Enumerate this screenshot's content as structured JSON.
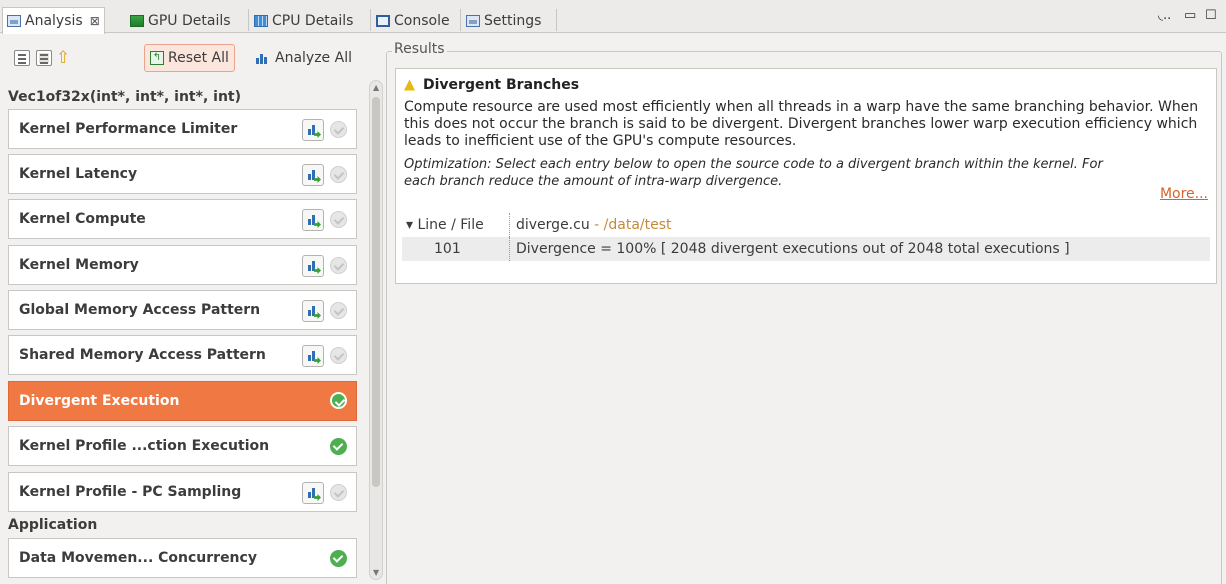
{
  "tabs": [
    {
      "label": "Analysis",
      "icon": "window-icon",
      "active": true,
      "close": "⊠"
    },
    {
      "label": "GPU Details",
      "icon": "gpu-icon"
    },
    {
      "label": "CPU Details",
      "icon": "cpu-icon"
    },
    {
      "label": "Console",
      "icon": "console-icon"
    },
    {
      "label": "Settings",
      "icon": "window-icon"
    }
  ],
  "window_controls": {
    "menu": "◟..",
    "minimize": "▭",
    "maximize": "☐"
  },
  "toolbar": {
    "reset_label": "Reset All",
    "analyze_label": "Analyze All"
  },
  "sections": {
    "kernel": "Vec1of32x(int*, int*, int*, int)",
    "application": "Application"
  },
  "items": [
    {
      "label": "Kernel Performance Limiter",
      "chart": true,
      "status": "gray"
    },
    {
      "label": "Kernel Latency",
      "chart": true,
      "status": "gray"
    },
    {
      "label": "Kernel Compute",
      "chart": true,
      "status": "gray"
    },
    {
      "label": "Kernel Memory",
      "chart": true,
      "status": "gray"
    },
    {
      "label": "Global Memory Access Pattern",
      "chart": true,
      "status": "gray"
    },
    {
      "label": "Shared Memory Access Pattern",
      "chart": true,
      "status": "gray"
    },
    {
      "label": "Divergent Execution",
      "chart": false,
      "status": "green",
      "selected": true
    },
    {
      "label": "Kernel Profile ...ction Execution",
      "chart": false,
      "status": "green"
    },
    {
      "label": "Kernel Profile - PC Sampling",
      "chart": true,
      "status": "gray"
    },
    {
      "label": "Data Movemen... Concurrency",
      "chart": false,
      "status": "green"
    }
  ],
  "results": {
    "group_label": "Results",
    "title": "Divergent Branches",
    "description": "Compute resource are used most efficiently when all threads in a warp have the same branching behavior. When this does not occur the branch is said to be divergent. Divergent branches lower warp execution efficiency which leads to inefficient use of the GPU's compute resources.",
    "optimization": "Optimization: Select each entry below to open the source code to a divergent branch within the kernel. For each branch reduce the amount of intra-warp divergence.",
    "more_link": "More...",
    "table": {
      "header_col": "▾ Line / File",
      "file": "diverge.cu",
      "path": " - /data/test",
      "row_line": "101",
      "row_text": "Divergence = 100% [ 2048 divergent executions out of 2048 total executions ]"
    }
  },
  "colors": {
    "selected": "#f07843",
    "accent_link": "#d9622b",
    "check_green": "#4caf50"
  }
}
